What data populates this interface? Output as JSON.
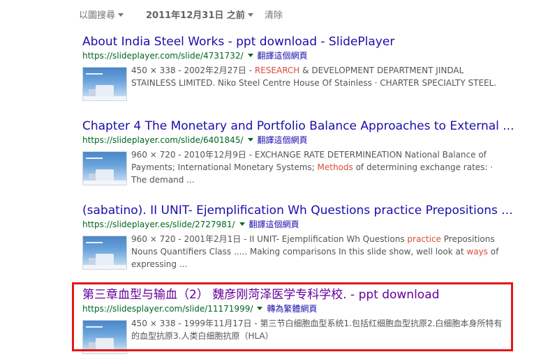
{
  "toolbar": {
    "search_by_image": "以圖搜尋",
    "date_filter": "2011年12月31日 之前",
    "clear": "清除"
  },
  "results": [
    {
      "title": "About India Steel Works - ppt download - SlidePlayer",
      "url": "https://slideplayer.com/slide/4731732/",
      "translate": "翻譯這個網頁",
      "meta": "450 × 338 - 2002年2月27日 - ",
      "snippet": [
        "RESEARCH",
        " & DEVELOPMENT DEPARTMENT JINDAL STAINLESS LIMITED. Niko Steel Centre House Of Stainless · CHARTER SPECIALTY STEEL."
      ]
    },
    {
      "title": "Chapter 4 The Monetary and Portfolio Balance Approaches to External ...",
      "url": "https://slideplayer.com/slide/6401845/",
      "translate": "翻譯這個網頁",
      "meta": "960 × 720 - 2010年12月9日 - ",
      "snippet": [
        "EXCHANGE RATE DETERMINEATION National Balance of Payments; International Monetary Systems; ",
        "Methods",
        " of determining exchange rates: · The demand ..."
      ]
    },
    {
      "title": "(sabatino). II UNIT- Ejemplification Wh Questions practice Prepositions ...",
      "url": "https://slideplayer.es/slide/2727981/",
      "translate": "翻譯這個網頁",
      "meta": "960 × 720 - 2001年2月1日 - ",
      "snippet": [
        "II UNIT- Ejemplification Wh Questions ",
        "practice",
        " Prepositions Nouns Quantifiers Class ..... Making comparisons In this slide show, well look at ",
        "ways",
        " of expressing ..."
      ]
    },
    {
      "title": "第三章血型与输血（2） 魏彦刚菏泽医学专科学校. - ppt download",
      "url": "https://slidesplayer.com/slide/11171999/",
      "translate": "轉為繁體網頁",
      "meta": "450 × 338 - 1999年11月17日 - ",
      "snippet": [
        "第三节白细胞血型系统1.包括红细胞血型抗原2.白细胞本身所特有的血型抗原3.人类白细胞抗原（HLA）"
      ]
    }
  ],
  "colors": {
    "title_link": "#1a0dab",
    "visited_link": "#660099",
    "url_green": "#006621",
    "keyword_highlight": "#dd4b39",
    "annotation_box": "#e21818"
  }
}
